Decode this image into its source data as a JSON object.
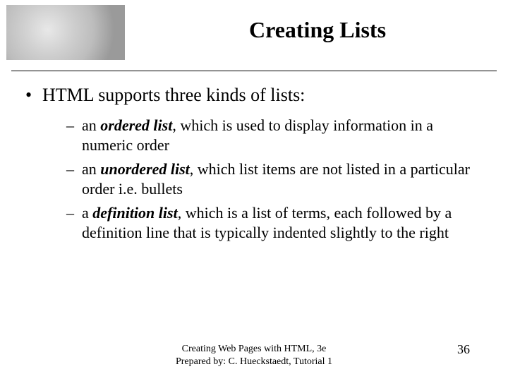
{
  "title": "Creating Lists",
  "bullets": [
    {
      "text": "HTML supports three kinds of lists:",
      "sub": [
        {
          "pre": "an ",
          "term": "ordered list",
          "post": ", which is used to display information in a numeric order"
        },
        {
          "pre": "an ",
          "term": "unordered list",
          "post": ", which list items are not listed in a particular order i.e. bullets"
        },
        {
          "pre": "a ",
          "term": "definition list",
          "post": ", which is a list of terms, each followed by a definition line that is typically indented slightly to the right"
        }
      ]
    }
  ],
  "footer": {
    "line1": "Creating Web Pages with HTML, 3e",
    "line2": "Prepared by: C. Hueckstaedt, Tutorial 1",
    "page": "36"
  }
}
